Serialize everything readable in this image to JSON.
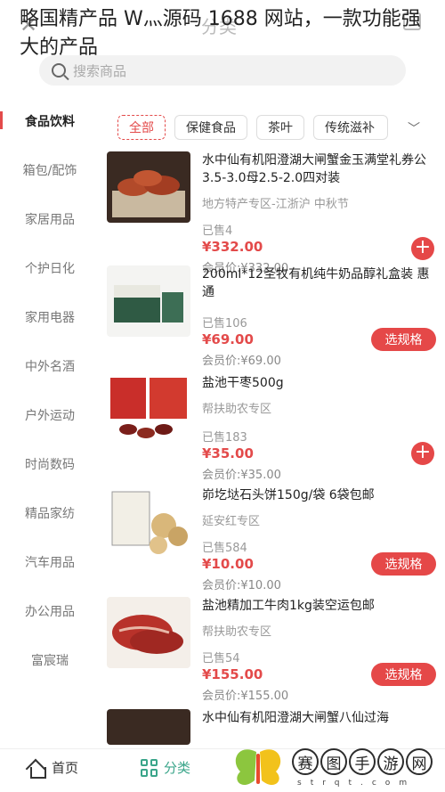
{
  "overlay_title": "略国精产品 W灬源码 1688 网站，一款功能强大的产品",
  "header": {
    "title": "分类",
    "back_icon": "close-icon"
  },
  "search": {
    "placeholder": "搜索商品"
  },
  "sidebar": {
    "items": [
      {
        "label": "食品饮料",
        "active": true
      },
      {
        "label": "箱包/配饰"
      },
      {
        "label": "家居用品"
      },
      {
        "label": "个护日化"
      },
      {
        "label": "家用电器"
      },
      {
        "label": "中外名酒"
      },
      {
        "label": "户外运动"
      },
      {
        "label": "时尚数码"
      },
      {
        "label": "精品家纺"
      },
      {
        "label": "汽车用品"
      },
      {
        "label": "办公用品"
      },
      {
        "label": "富宸瑞"
      }
    ]
  },
  "tabs": [
    {
      "label": "全部",
      "active": true
    },
    {
      "label": "保健食品"
    },
    {
      "label": "茶叶"
    },
    {
      "label": "传统滋补"
    }
  ],
  "products": [
    {
      "title": "水中仙有机阳澄湖大闸蟹金玉满堂礼券公3.5-3.0母2.5-2.0四对装",
      "tag": "地方特产专区-江浙沪 中秋节",
      "sold": "已售4",
      "price": "¥332.00",
      "member": "会员价:¥332.00",
      "action": "add"
    },
    {
      "title": "200ml*12圣牧有机纯牛奶品醇礼盒装 惠通",
      "tag": "",
      "sold": "已售106",
      "price": "¥69.00",
      "member": "会员价:¥69.00",
      "action": "spec",
      "action_label": "选规格"
    },
    {
      "title": "盐池干枣500g",
      "tag": "帮扶助农专区",
      "sold": "已售183",
      "price": "¥35.00",
      "member": "会员价:¥35.00",
      "action": "add"
    },
    {
      "title": "峁圪垯石头饼150g/袋 6袋包邮",
      "tag": "延安红专区",
      "sold": "已售584",
      "price": "¥10.00",
      "member": "会员价:¥10.00",
      "action": "spec",
      "action_label": "选规格"
    },
    {
      "title": "盐池精加工牛肉1kg装空运包邮",
      "tag": "帮扶助农专区",
      "sold": "已售54",
      "price": "¥155.00",
      "member": "会员价:¥155.00",
      "action": "spec",
      "action_label": "选规格"
    },
    {
      "title": "水中仙有机阳澄湖大闸蟹八仙过海",
      "tag": "",
      "sold": "",
      "price": "",
      "member": "",
      "action": "none"
    }
  ],
  "bottom_nav": [
    {
      "label": "首页",
      "icon": "home-icon"
    },
    {
      "label": "分类",
      "icon": "grid-icon",
      "active": true
    }
  ],
  "watermark": {
    "chars": [
      "赛",
      "图",
      "手",
      "游",
      "网"
    ],
    "sub": "strqt.com"
  },
  "colors": {
    "accent": "#e34a4a",
    "nav_active": "#3aa58a"
  }
}
